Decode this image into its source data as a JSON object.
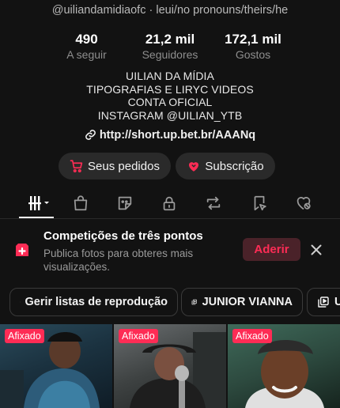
{
  "profile": {
    "handle_line": "@uiliandamidiaofc · leui/no pronouns/theirs/he",
    "stats": [
      {
        "value": "490",
        "label": "A seguir"
      },
      {
        "value": "21,2 mil",
        "label": "Seguidores"
      },
      {
        "value": "172,1 mil",
        "label": "Gostos"
      }
    ],
    "bio": [
      "UILIAN DA MÍDIA",
      "TIPOGRAFIAS E LIRYC VIDEOS",
      "CONTA OFICIAL",
      "INSTAGRAM @UILIAN_YTB"
    ],
    "link": "http://short.up.bet.br/AAANq"
  },
  "actions": {
    "orders_label": "Seus pedidos",
    "subscription_label": "Subscrição"
  },
  "tabs": [
    "videos-grid-icon",
    "shop-bag-icon",
    "sticker-icon",
    "lock-icon",
    "repost-icon",
    "favorites-icon",
    "liked-icon"
  ],
  "promo": {
    "title": "Competições de três pontos",
    "description": "Publica fotos para obteres mais visualizações.",
    "join_label": "Aderir"
  },
  "chips": {
    "manage_label": "Gerir listas de reprodução",
    "junior_label": "JUNIOR VIANNA",
    "more_label": "U"
  },
  "videos": [
    {
      "badge": "Afixado"
    },
    {
      "badge": "Afixado"
    },
    {
      "badge": "Afixado"
    }
  ],
  "colors": {
    "background": "#121212",
    "accent": "#fe2c55",
    "pill_bg": "#2a2a2a",
    "muted_text": "#8e8e8e"
  }
}
